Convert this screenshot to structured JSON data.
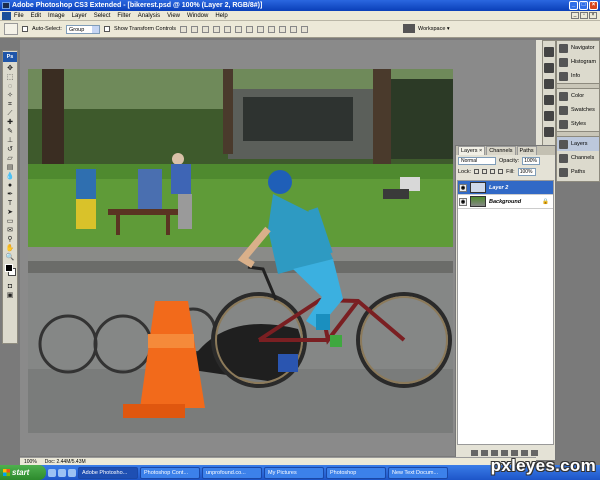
{
  "window": {
    "title": "Adobe Photoshop CS3 Extended - [bikerest.psd @ 100% (Layer 2, RGB/8#)]"
  },
  "menu": [
    "File",
    "Edit",
    "Image",
    "Layer",
    "Select",
    "Filter",
    "Analysis",
    "View",
    "Window",
    "Help"
  ],
  "options_bar": {
    "auto_select_label": "Auto-Select:",
    "auto_select_value": "Group",
    "show_transform_label": "Show Transform Controls",
    "workspace_label": "Workspace ▾"
  },
  "toolbox": {
    "badge": "Ps"
  },
  "right_dock": {
    "group1": [
      "Navigator",
      "Histogram",
      "Info"
    ],
    "group2": [
      "Color",
      "Swatches",
      "Styles"
    ],
    "group3": [
      "Layers",
      "Channels",
      "Paths"
    ]
  },
  "layers_panel": {
    "tabs": [
      "Layers ×",
      "Channels",
      "Paths"
    ],
    "blend_mode": "Normal",
    "opacity_label": "Opacity:",
    "opacity_value": "100%",
    "lock_label": "Lock:",
    "fill_label": "Fill:",
    "fill_value": "100%",
    "layers": [
      {
        "name": "Layer 2",
        "selected": true
      },
      {
        "name": "Background",
        "selected": false
      }
    ]
  },
  "status": {
    "zoom": "100%",
    "doc": "Doc: 2.44M/5.43M"
  },
  "taskbar": {
    "start": "start",
    "tasks": [
      "Adobe Photosho...",
      "Photoshop Cont...",
      "unprofound.co...",
      "My Pictures",
      "Photoshop",
      "New Text Docum..."
    ]
  },
  "watermark": "pxleyes.com",
  "colors": {
    "title_blue": "#0a3fb8",
    "taskbar_blue": "#2a66d6",
    "selection_blue": "#3169c6",
    "cone_orange": "#f26a1b"
  }
}
